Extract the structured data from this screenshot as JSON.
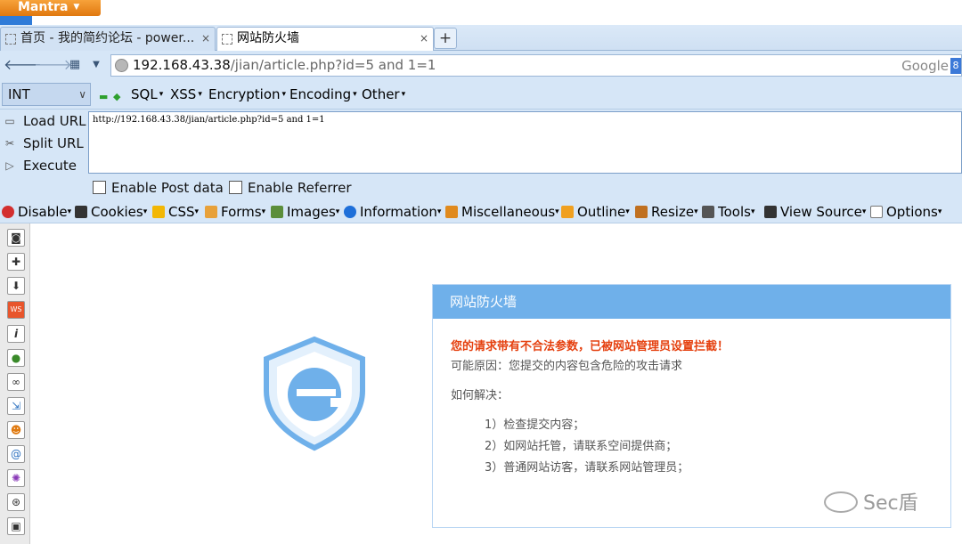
{
  "app": {
    "name": "Mantra"
  },
  "tabs": [
    {
      "title": "首页 - 我的简约论坛 - power...",
      "close": "×"
    },
    {
      "title": "网站防火墙",
      "close": "×"
    }
  ],
  "new_tab_label": "+",
  "nav": {
    "url_host": "192.168.43.38",
    "url_path": "/jian/article.php?id=5 and 1=1",
    "search_engine": "Google",
    "search_icon_letter": "8"
  },
  "hackbar": {
    "type_select": "INT",
    "menus": [
      "SQL",
      "XSS",
      "Encryption",
      "Encoding",
      "Other"
    ],
    "load_url": "Load URL",
    "split_url": "Split URL",
    "execute": "Execute",
    "url_value": "http://192.168.43.38/jian/article.php?id=5 and 1=1",
    "enable_post": "Enable Post data",
    "enable_referrer": "Enable Referrer"
  },
  "devtoolbar": {
    "items": [
      "Disable",
      "Cookies",
      "CSS",
      "Forms",
      "Images",
      "Information",
      "Miscellaneous",
      "Outline",
      "Resize",
      "Tools",
      "View Source",
      "Options"
    ],
    "colors": [
      "#d32f2f",
      "#333333",
      "#f2b705",
      "#e8a13a",
      "#5b8e3a",
      "#1e6fd9",
      "#e08a1e",
      "#f0a020",
      "#c07020",
      "#555555",
      "#333333",
      "#777777"
    ]
  },
  "page": {
    "panel_title": "网站防火墙",
    "warning": "您的请求带有不合法参数，已被网站管理员设置拦截！",
    "reason": "可能原因：您提交的内容包含危险的攻击请求",
    "howto": "如何解决：",
    "steps": [
      "1）检查提交内容；",
      "2）如网站托管，请联系空间提供商；",
      "3）普通网站访客，请联系网站管理员；"
    ],
    "watermark": "Sec盾",
    "accent": "#6fb0ea",
    "warning_color": "#e5400f"
  }
}
